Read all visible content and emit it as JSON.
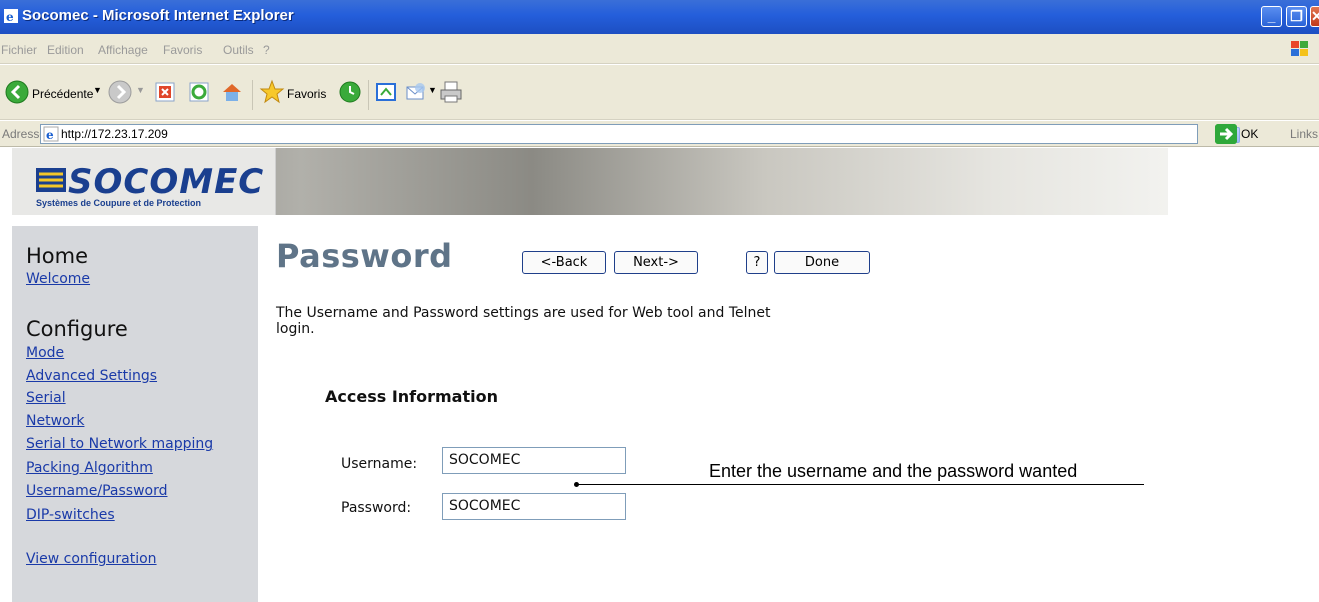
{
  "window": {
    "title": "Socomec - Microsoft Internet Explorer",
    "controls": {
      "minimize": "_",
      "maximize": "❐",
      "close": "✕"
    }
  },
  "menubar": {
    "items": [
      "Fichier",
      "Edition",
      "Affichage",
      "Favoris",
      "Outils",
      "?"
    ]
  },
  "toolbar": {
    "back_label": "Précédente",
    "favorites_label": "Favoris"
  },
  "addressbar": {
    "label": "Adresse",
    "url": "http://172.23.17.209",
    "go_label": "OK",
    "links_label": "Links"
  },
  "banner": {
    "logo_text": "SOCOMEC",
    "logo_tagline": "Systèmes de Coupure et de Protection"
  },
  "sidebar": {
    "home_heading": "Home",
    "home_links": [
      "Welcome"
    ],
    "configure_heading": "Configure",
    "configure_links": [
      "Mode",
      "Advanced Settings",
      "Serial",
      "Network",
      "Serial to Network mapping",
      "Packing Algorithm",
      "Username/Password",
      "DIP-switches"
    ],
    "view_link": "View configuration"
  },
  "main": {
    "title": "Password",
    "buttons": {
      "back": "<-Back",
      "next": "Next->",
      "help": "?",
      "done": "Done"
    },
    "intro": "The Username and Password settings are used for Web tool and Telnet login.",
    "section_heading": "Access Information",
    "username_label": "Username:",
    "username_value": "SOCOMEC",
    "password_label": "Password:",
    "password_value": "SOCOMEC"
  },
  "annotation": {
    "text": "Enter the username and the password wanted"
  },
  "colors": {
    "titlebar": "#245edb",
    "chrome": "#ece9d8",
    "sidebar": "#d6d8dc",
    "link": "#1a3aa8",
    "page_title": "#5f7488"
  }
}
